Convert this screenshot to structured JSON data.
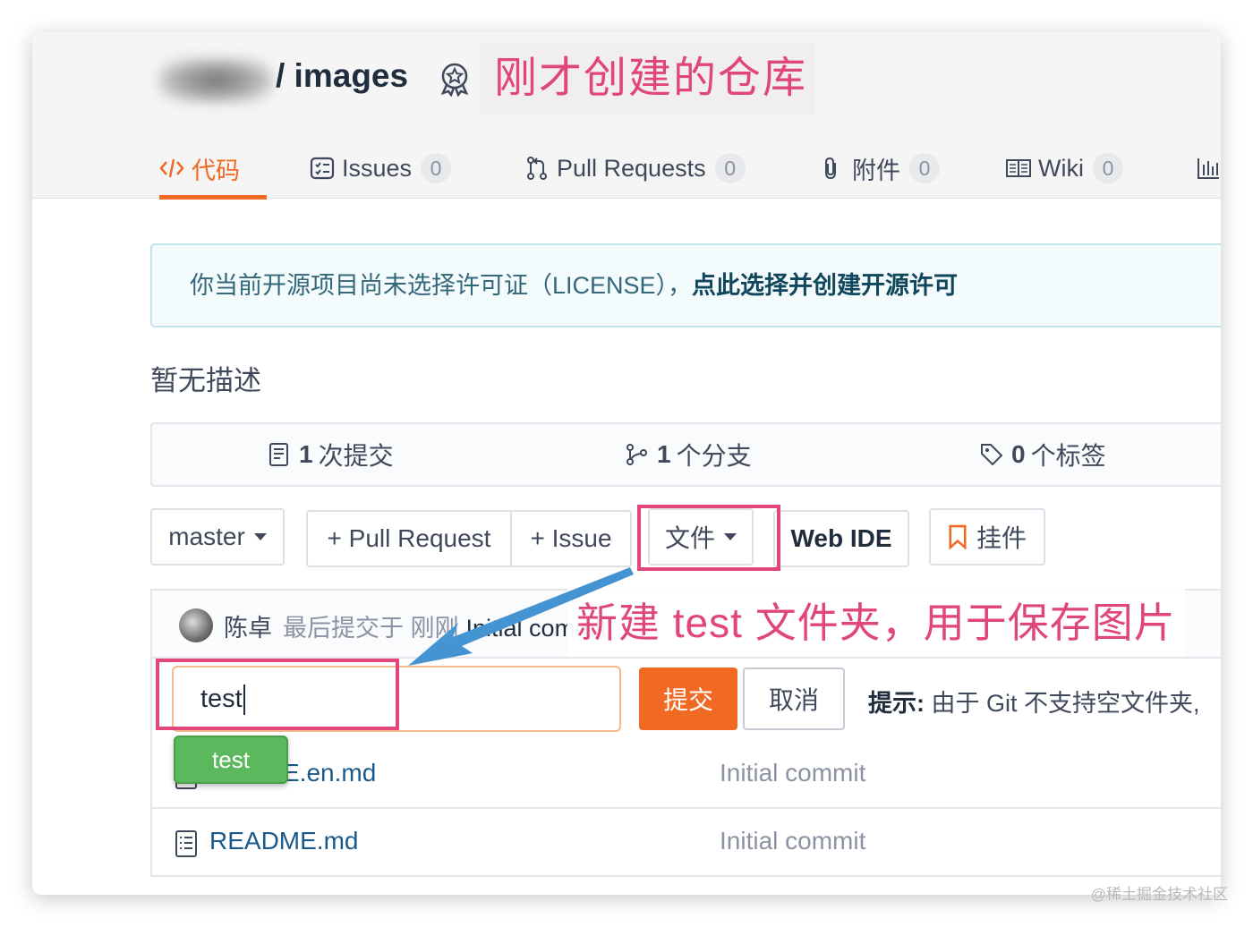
{
  "repo": {
    "name": "/ images"
  },
  "annotations": {
    "repo_created": "刚才创建的仓库",
    "new_folder": "新建 test 文件夹，用于保存图片"
  },
  "tabs": [
    {
      "label": "代码",
      "icon": "code-icon"
    },
    {
      "label": "Issues",
      "icon": "issues-icon",
      "count": "0"
    },
    {
      "label": "Pull Requests",
      "icon": "pull-request-icon",
      "count": "0"
    },
    {
      "label": "附件",
      "icon": "paperclip-icon",
      "count": "0"
    },
    {
      "label": "Wiki",
      "icon": "book-icon",
      "count": "0"
    }
  ],
  "notice": {
    "text": "你当前开源项目尚未选择许可证（LICENSE），",
    "link": "点此选择并创建开源许可"
  },
  "description": "暂无描述",
  "stats": {
    "commits": {
      "count": "1",
      "label": "次提交"
    },
    "branches": {
      "count": "1",
      "label": "个分支"
    },
    "tags": {
      "count": "0",
      "label": "个标签"
    }
  },
  "toolbar": {
    "branch": "master",
    "pull_request": "+ Pull Request",
    "issue": "+ Issue",
    "file": "文件",
    "web_ide": "Web IDE",
    "widget": "挂件"
  },
  "commit": {
    "author": "陈卓",
    "text": "最后提交于 刚刚",
    "message": "Initial commit"
  },
  "new_folder": {
    "value": "test",
    "submit": "提交",
    "cancel": "取消",
    "hint_label": "提示:",
    "hint_text": "由于 Git 不支持空文件夹,"
  },
  "autocomplete": "test",
  "files": [
    {
      "name": "README.en.md",
      "visible_name": "E.en.md",
      "commit": "Initial commit"
    },
    {
      "name": "README.md",
      "commit": "Initial commit"
    }
  ],
  "watermark": "@稀土掘金技术社区",
  "colors": {
    "accent": "#f06a24",
    "annotation": "#e0457b",
    "link": "#1a5a8a",
    "suggest": "#5cb85c"
  }
}
